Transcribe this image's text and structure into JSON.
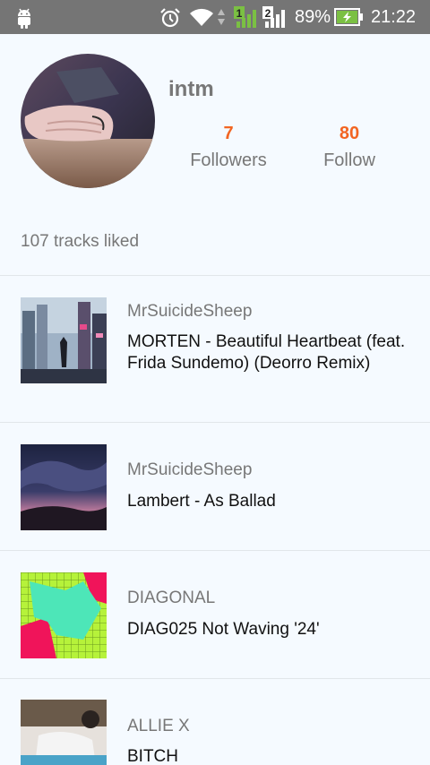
{
  "status_bar": {
    "battery_percent": "89%",
    "time": "21:22",
    "sim1_label": "1",
    "sim2_label": "2",
    "accent_battery": "#7bc043",
    "icons": [
      "android-icon",
      "alarm-icon",
      "wifi-icon",
      "data-arrows-icon",
      "sim1-signal-icon",
      "sim2-signal-icon",
      "battery-charging-icon"
    ]
  },
  "profile": {
    "username": "intm",
    "followers_count": "7",
    "followers_label": "Followers",
    "follow_count": "80",
    "follow_label": "Follow",
    "accent_color": "#f26522"
  },
  "likes": {
    "summary": "107 tracks liked"
  },
  "tracks": [
    {
      "artist": "MrSuicideSheep",
      "title": "MORTEN - Beautiful Heartbeat (feat. Frida Sundemo) (Deorro Remix)"
    },
    {
      "artist": "MrSuicideSheep",
      "title": "Lambert - As Ballad"
    },
    {
      "artist": "DIAGONAL",
      "title": "DIAG025 Not Waving '24'"
    },
    {
      "artist": "ALLIE X",
      "title": "BITCH"
    }
  ]
}
